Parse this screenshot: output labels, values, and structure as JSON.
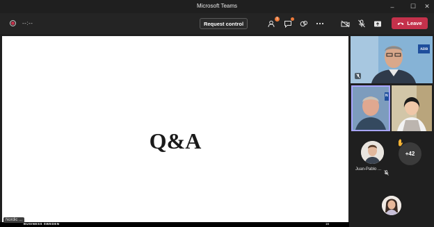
{
  "window": {
    "title": "Microsoft Teams",
    "minimize_glyph": "–",
    "maximize_glyph": "☐",
    "close_glyph": "✕"
  },
  "toolbar": {
    "timer": "--:--",
    "request_control_label": "Request control",
    "people_badge": "1",
    "leave_label": "Leave",
    "icons": [
      "record-icon",
      "people-icon",
      "chat-icon",
      "reactions-icon",
      "more-icon",
      "camera-off-icon",
      "mic-off-icon",
      "share-icon",
      "phone-icon"
    ]
  },
  "presentation": {
    "slide_text": "Q&A",
    "footer_org": "BUSINESS SWEDEN",
    "footer_page": "16",
    "presenter_chip": "Nordic ..."
  },
  "participants": {
    "tile_top_logo": "ADB",
    "tile_left_logo": "N",
    "jp_name": "Juan-Pablo ...",
    "overflow_count": "+42"
  },
  "colors": {
    "accent_leave": "#c4314b",
    "active_speaker_border": "#a8a5ff",
    "adb_blue": "#1e4e9c"
  }
}
